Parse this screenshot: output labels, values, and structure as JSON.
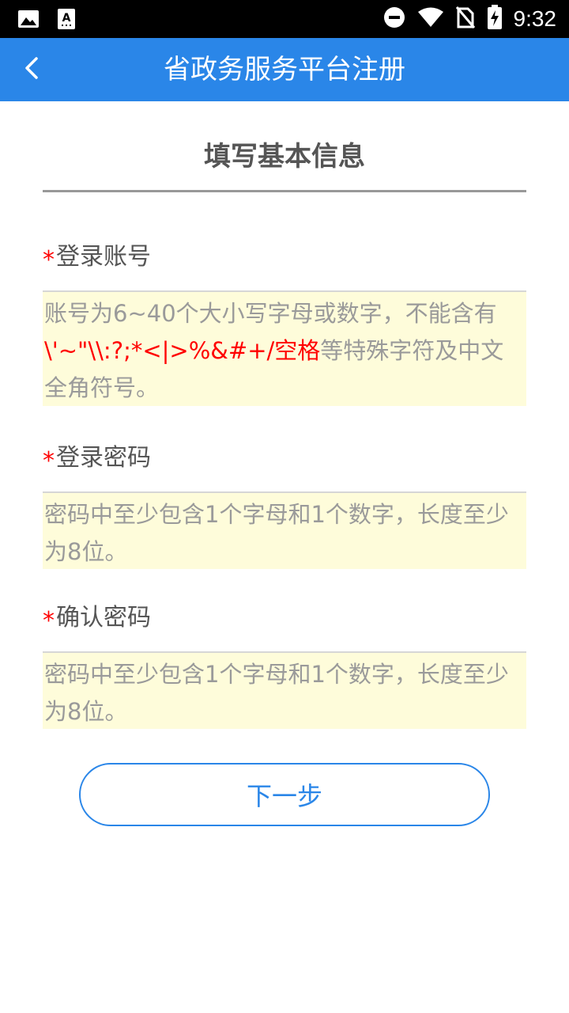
{
  "status_bar": {
    "time": "9:32",
    "icons": [
      "image-icon",
      "keyboard-a-icon",
      "do-not-disturb-icon",
      "wifi-icon",
      "no-sim-icon",
      "battery-charging-icon"
    ]
  },
  "app_bar": {
    "title": "省政务服务平台注册",
    "back_icon": "chevron-left-icon",
    "color": "#2a86e8"
  },
  "section": {
    "title": "填写基本信息"
  },
  "fields": {
    "account": {
      "required_mark": "*",
      "label": "登录账号",
      "placeholder_part1": "账号为6~40个大小写字母或数字，不能含有",
      "placeholder_special": "\\'~\"\\\\:?;*<|>%&#+/空格",
      "placeholder_part2": "等特殊字符及中文全角符号。"
    },
    "password": {
      "required_mark": "*",
      "label": "登录密码",
      "placeholder": "密码中至少包含1个字母和1个数字，长度至少为8位。"
    },
    "confirm_password": {
      "required_mark": "*",
      "label": "确认密码",
      "placeholder": "密码中至少包含1个字母和1个数字，长度至少为8位。"
    }
  },
  "actions": {
    "next_label": "下一步"
  },
  "colors": {
    "accent": "#2a86e8",
    "required": "#ff0000",
    "input_bg": "#fefcda"
  }
}
